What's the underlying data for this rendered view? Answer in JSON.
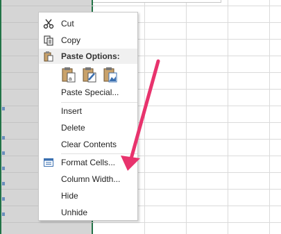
{
  "menu": {
    "items": [
      {
        "label": "Cut",
        "icon": "scissors-icon"
      },
      {
        "label": "Copy",
        "icon": "copy-icon"
      },
      {
        "label": "Paste Options:",
        "icon": "clipboard-icon"
      },
      {
        "label": "Paste Special...",
        "icon": ""
      },
      {
        "label": "Insert",
        "icon": ""
      },
      {
        "label": "Delete",
        "icon": ""
      },
      {
        "label": "Clear Contents",
        "icon": ""
      },
      {
        "label": "Format Cells...",
        "icon": "format-cells-icon"
      },
      {
        "label": "Column Width...",
        "icon": ""
      },
      {
        "label": "Hide",
        "icon": ""
      },
      {
        "label": "Unhide",
        "icon": ""
      }
    ],
    "paste_options": [
      "paste-values-icon",
      "paste-formatting-icon",
      "paste-picture-icon"
    ]
  },
  "colors": {
    "selected_column": "#d5d5d5",
    "column_border": "#217346",
    "highlight": "#e8336d",
    "arrow": "#e8336d"
  }
}
